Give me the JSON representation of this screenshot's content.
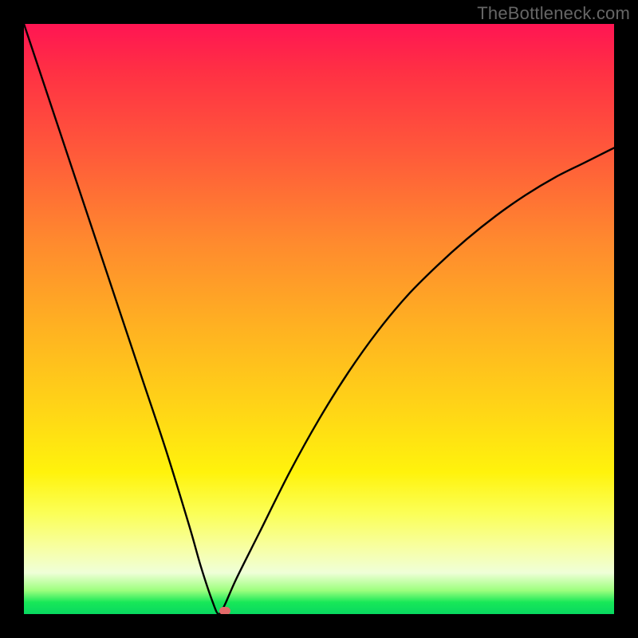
{
  "watermark": "TheBottleneck.com",
  "chart_data": {
    "type": "line",
    "title": "",
    "xlabel": "",
    "ylabel": "",
    "xlim": [
      0,
      100
    ],
    "ylim": [
      0,
      100
    ],
    "grid": false,
    "legend": false,
    "annotations": [],
    "minimum_x": 33,
    "minimum_y": 0,
    "marker": {
      "x": 34,
      "y": 0.5
    },
    "series": [
      {
        "name": "curve",
        "x": [
          0,
          4,
          8,
          12,
          16,
          20,
          24,
          28,
          30,
          32,
          33,
          34,
          36,
          40,
          45,
          50,
          55,
          60,
          65,
          70,
          75,
          80,
          85,
          90,
          95,
          100
        ],
        "y": [
          100,
          88,
          76,
          64,
          52,
          40,
          28,
          15,
          8,
          2,
          0,
          1.5,
          6,
          14,
          24,
          33,
          41,
          48,
          54,
          59,
          63.5,
          67.5,
          71,
          74,
          76.5,
          79
        ]
      }
    ],
    "background_gradient": {
      "direction": "vertical",
      "top_color": "#ff1553",
      "bottom_color": "#08d860",
      "band_colors": [
        "#ff1553",
        "#ff5a3a",
        "#ffb321",
        "#fff30c",
        "#f7ffa6",
        "#18e858"
      ]
    },
    "frame_color": "#000000"
  }
}
